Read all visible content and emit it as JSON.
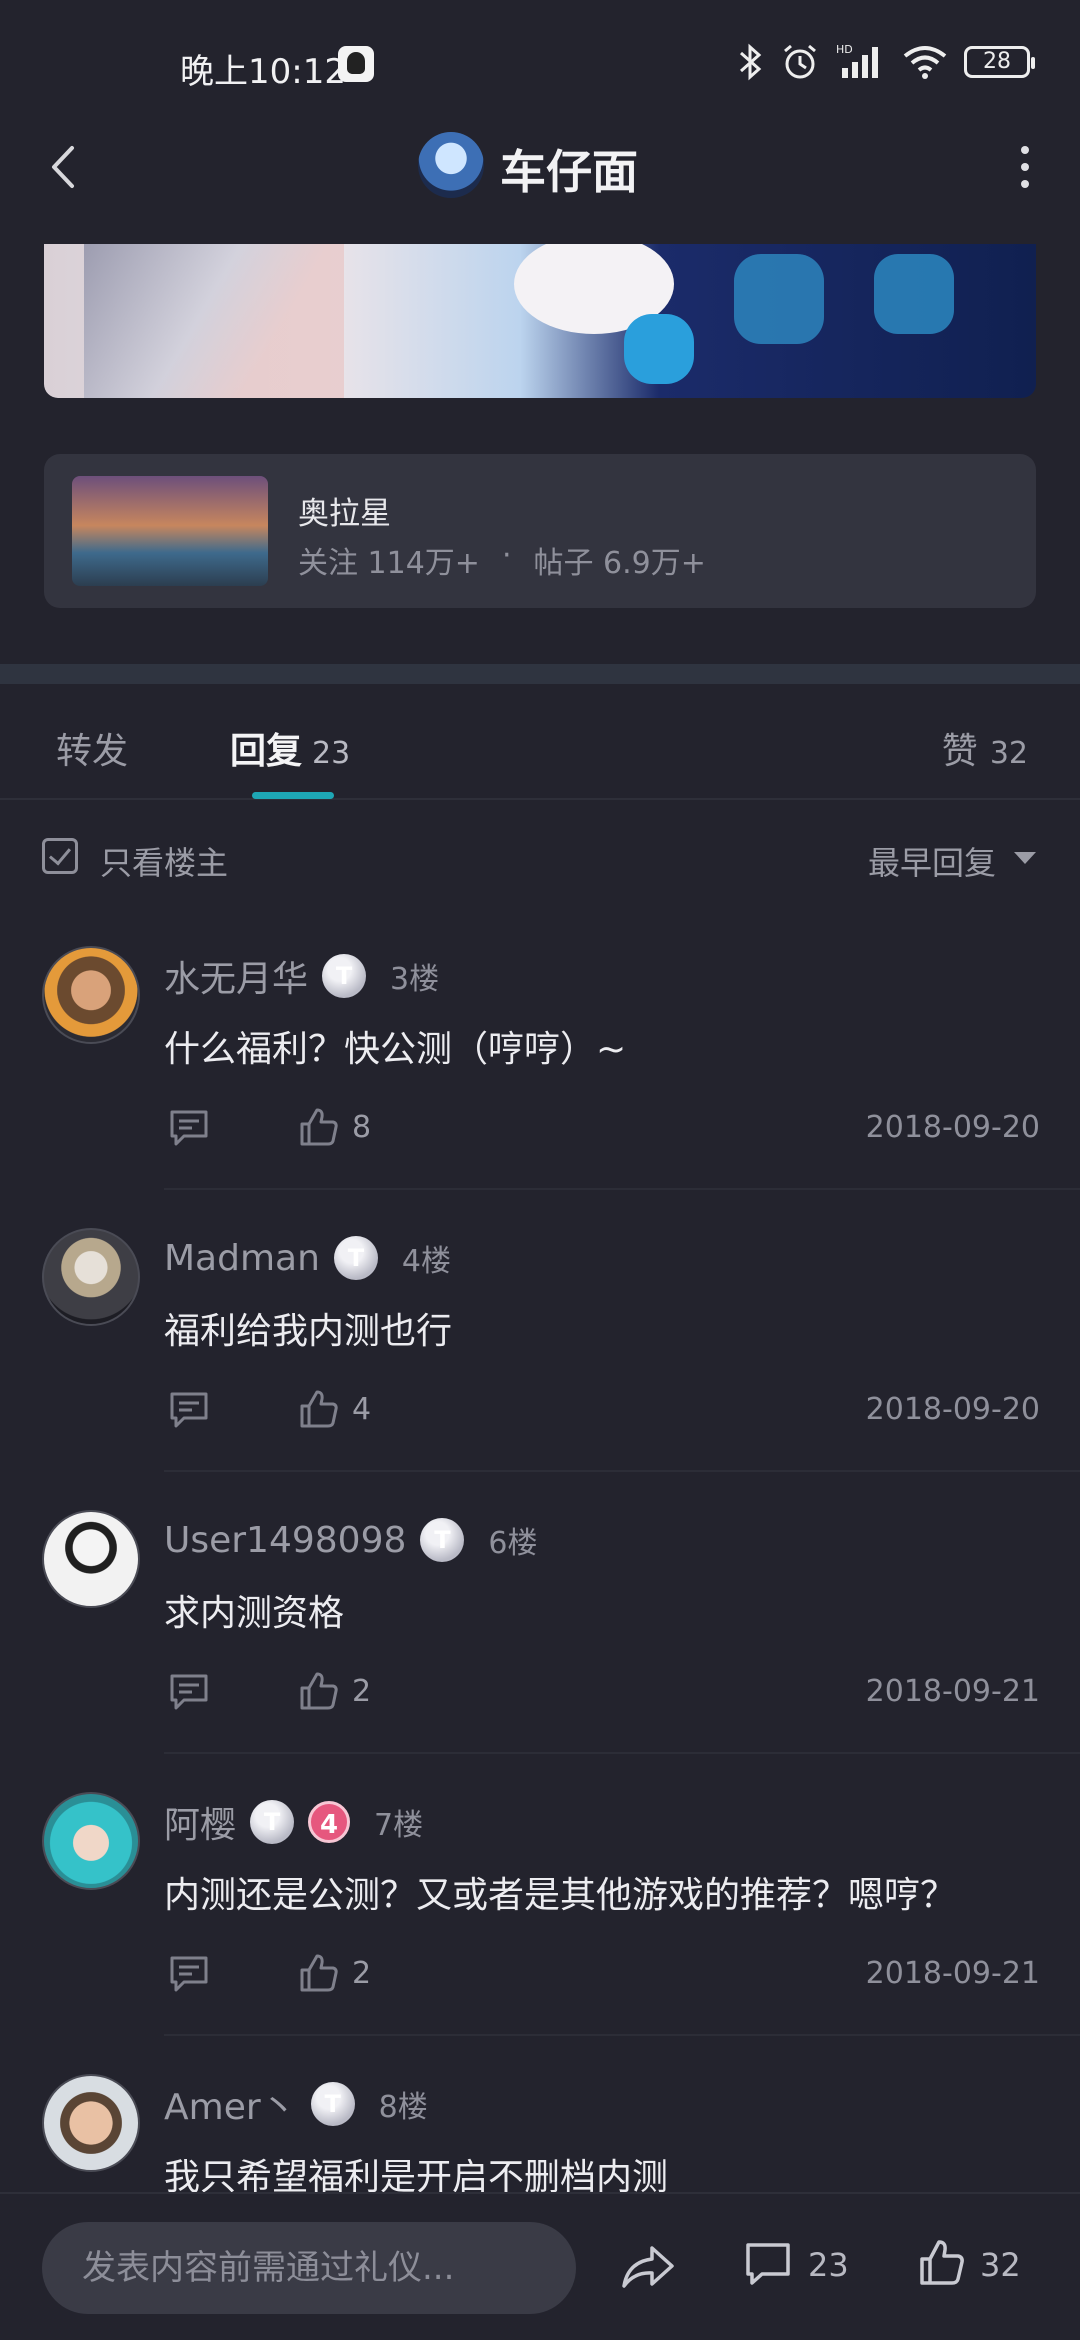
{
  "status_bar": {
    "time": "晚上10:12",
    "battery": "28",
    "icons": [
      "qq-icon",
      "bluetooth-icon",
      "alarm-icon",
      "hd-signal-icon",
      "wifi-icon",
      "battery-icon"
    ]
  },
  "header": {
    "title": "车仔面",
    "back_icon": "chevron-left-icon",
    "more_icon": "more-vertical-icon"
  },
  "game_card": {
    "name": "奥拉星",
    "followers": "关注 114万+",
    "separator": "·",
    "posts": "帖子 6.9万+"
  },
  "tabs": {
    "repost": "转发",
    "reply": "回复",
    "reply_count": "23",
    "like": "赞",
    "like_count": "32"
  },
  "filter": {
    "only_op": "只看楼主",
    "sort": "最早回复"
  },
  "comments": [
    {
      "name": "水无月华",
      "level": "T",
      "floor": "3楼",
      "text": "什么福利？快公测（哼哼）~",
      "likes": "8",
      "date": "2018-09-20"
    },
    {
      "name": "Madman",
      "level": "T",
      "floor": "4楼",
      "text": "福利给我内测也行",
      "likes": "4",
      "date": "2018-09-20"
    },
    {
      "name": "User1498098",
      "level": "T",
      "floor": "6楼",
      "text": "求内测资格",
      "likes": "2",
      "date": "2018-09-21"
    },
    {
      "name": "阿樱",
      "level": "T",
      "fan_level": "4",
      "floor": "7楼",
      "text": "内测还是公测？又或者是其他游戏的推荐？嗯哼？",
      "likes": "2",
      "date": "2018-09-21"
    },
    {
      "name": "Amer丶",
      "level": "T",
      "floor": "8楼",
      "text": "我只希望福利是开启不删档内测"
    }
  ],
  "bottom_bar": {
    "input_placeholder": "发表内容前需通过礼仪...",
    "comment_count": "23",
    "like_count": "32"
  },
  "colors": {
    "background": "#23232d",
    "card": "#33343f",
    "accent": "#1ea7b5"
  }
}
